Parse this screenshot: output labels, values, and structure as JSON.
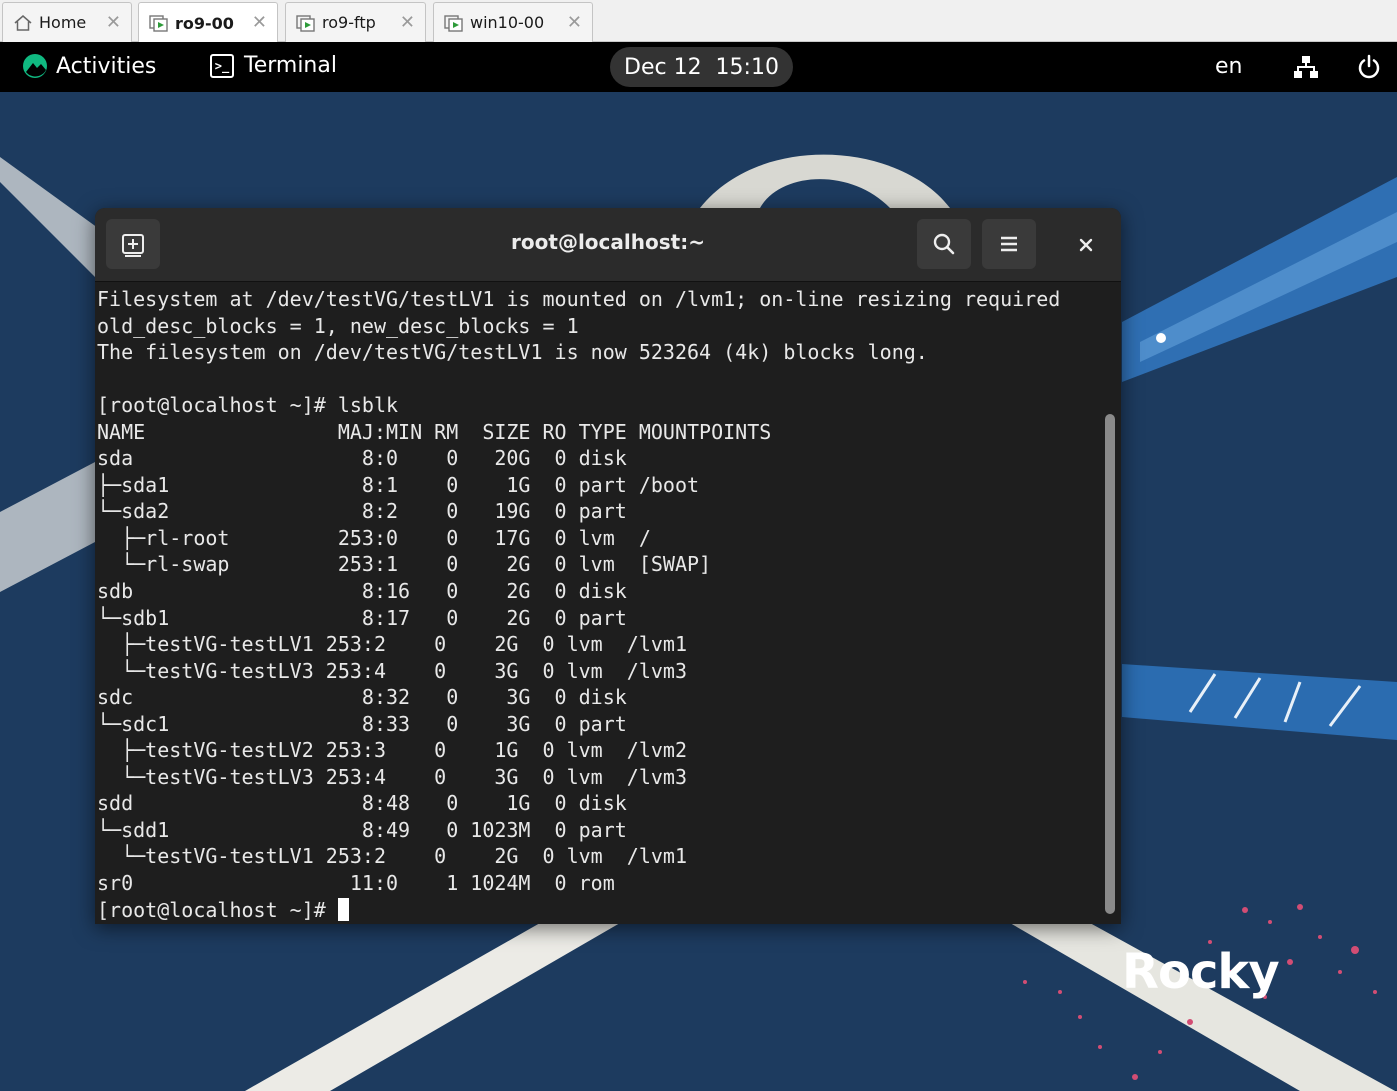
{
  "vmware_tabs": [
    {
      "label": "Home",
      "icon": "home-icon",
      "active": false
    },
    {
      "label": "ro9-00",
      "icon": "vm-icon",
      "active": true
    },
    {
      "label": "ro9-ftp",
      "icon": "vm-icon",
      "active": false
    },
    {
      "label": "win10-00",
      "icon": "vm-icon",
      "active": false
    }
  ],
  "topbar": {
    "activities": "Activities",
    "app_name": "Terminal",
    "clock": "Dec 12  15:10",
    "language": "en",
    "icons": [
      "network-icon",
      "power-icon"
    ]
  },
  "desktop": {
    "brand_text": "Rocky"
  },
  "terminal": {
    "title": "root@localhost:~",
    "lines": [
      "Filesystem at /dev/testVG/testLV1 is mounted on /lvm1; on-line resizing required",
      "old_desc_blocks = 1, new_desc_blocks = 1",
      "The filesystem on /dev/testVG/testLV1 is now 523264 (4k) blocks long.",
      "",
      "[root@localhost ~]# lsblk",
      "NAME                MAJ:MIN RM  SIZE RO TYPE MOUNTPOINTS",
      "sda                   8:0    0   20G  0 disk",
      "├─sda1                8:1    0    1G  0 part /boot",
      "└─sda2                8:2    0   19G  0 part",
      "  ├─rl-root         253:0    0   17G  0 lvm  /",
      "  └─rl-swap         253:1    0    2G  0 lvm  [SWAP]",
      "sdb                   8:16   0    2G  0 disk",
      "└─sdb1                8:17   0    2G  0 part",
      "  ├─testVG-testLV1 253:2    0    2G  0 lvm  /lvm1",
      "  └─testVG-testLV3 253:4    0    3G  0 lvm  /lvm3",
      "sdc                   8:32   0    3G  0 disk",
      "└─sdc1                8:33   0    3G  0 part",
      "  ├─testVG-testLV2 253:3    0    1G  0 lvm  /lvm2",
      "  └─testVG-testLV3 253:4    0    3G  0 lvm  /lvm3",
      "sdd                   8:48   0    1G  0 disk",
      "└─sdd1                8:49   0 1023M  0 part",
      "  └─testVG-testLV1 253:2    0    2G  0 lvm  /lvm1",
      "sr0                  11:0    1 1024M  0 rom"
    ],
    "prompt": "[root@localhost ~]# "
  },
  "colors": {
    "desktop_bg": "#1d3b5f",
    "topbar_bg": "#000000",
    "terminal_bg": "#1e1e1e",
    "header_bg": "#2b2b2b",
    "rocky_green": "#10b981"
  }
}
